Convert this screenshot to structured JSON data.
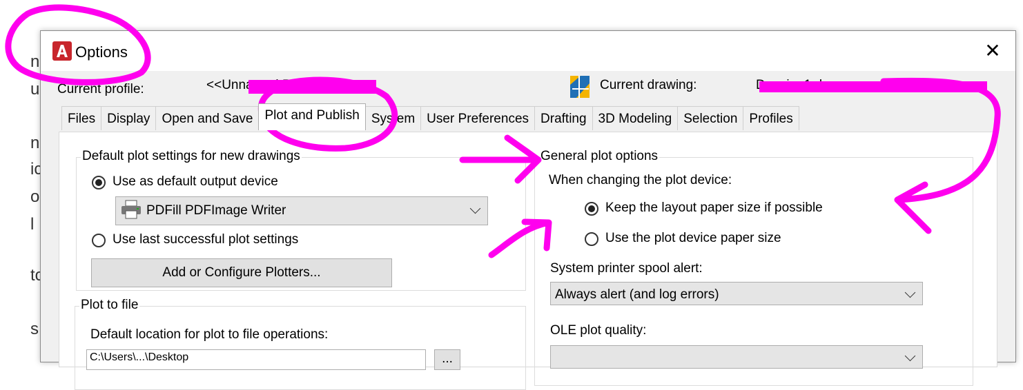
{
  "background": {
    "fragments": [
      "nc",
      "ur",
      "nl",
      "ic",
      "o",
      "l",
      "to",
      "s"
    ]
  },
  "dialog": {
    "title": "Options",
    "close_icon": "close-icon",
    "current_profile_label": "Current profile:",
    "current_profile_value": "<<Unnamed Profile>>",
    "current_drawing_label": "Current drawing:",
    "current_drawing_value": "Drawing1.dwg"
  },
  "tabs": [
    {
      "label": "Files",
      "active": false
    },
    {
      "label": "Display",
      "active": false
    },
    {
      "label": "Open and Save",
      "active": false
    },
    {
      "label": "Plot and Publish",
      "active": true
    },
    {
      "label": "System",
      "active": false
    },
    {
      "label": "User Preferences",
      "active": false
    },
    {
      "label": "Drafting",
      "active": false
    },
    {
      "label": "3D Modeling",
      "active": false
    },
    {
      "label": "Selection",
      "active": false
    },
    {
      "label": "Profiles",
      "active": false
    }
  ],
  "default_plot": {
    "group_title": "Default plot settings for new drawings",
    "use_default_device_label": "Use as default output device",
    "use_default_device_checked": true,
    "device_value": "PDFill PDFImage Writer",
    "use_last_label": "Use last successful plot settings",
    "use_last_checked": false,
    "add_plotters_label": "Add or Configure Plotters..."
  },
  "plot_to_file": {
    "group_title": "Plot to file",
    "location_label": "Default location for plot to file operations:",
    "location_value": "C:\\Users\\...\\Desktop",
    "browse_label": "..."
  },
  "general_plot": {
    "group_title": "General plot options",
    "changing_device_label": "When changing the plot device:",
    "keep_layout_label": "Keep the layout paper size if possible",
    "keep_layout_checked": true,
    "use_device_label": "Use the plot device paper size",
    "use_device_checked": false,
    "spool_alert_label": "System printer spool alert:",
    "spool_alert_value": "Always alert (and log errors)",
    "ole_quality_label": "OLE plot quality:"
  },
  "colors": {
    "annotation": "#ff00ee",
    "dialog_bg": "#f0f0f0",
    "autocad_red": "#c8262c"
  }
}
